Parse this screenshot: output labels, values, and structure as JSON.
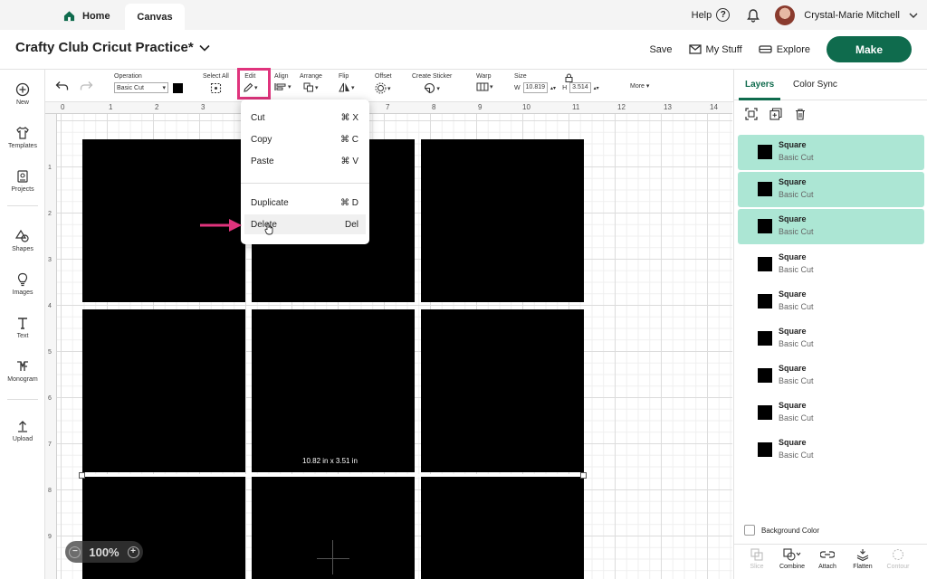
{
  "topbar": {
    "home_label": "Home",
    "canvas_label": "Canvas",
    "help_label": "Help",
    "user_name": "Crystal-Marie Mitchell"
  },
  "titlebar": {
    "project_title": "Crafty Club Cricut Practice*",
    "save_label": "Save",
    "mystuff_label": "My Stuff",
    "explore_label": "Explore",
    "make_label": "Make"
  },
  "leftbar": {
    "items": [
      {
        "label": "New",
        "icon": "plus-circle-icon"
      },
      {
        "label": "Templates",
        "icon": "shirt-icon"
      },
      {
        "label": "Projects",
        "icon": "projects-icon"
      },
      {
        "label": "Shapes",
        "icon": "shapes-icon"
      },
      {
        "label": "Images",
        "icon": "lightbulb-icon"
      },
      {
        "label": "Text",
        "icon": "text-icon"
      },
      {
        "label": "Monogram",
        "icon": "monogram-icon"
      },
      {
        "label": "Upload",
        "icon": "upload-icon"
      }
    ]
  },
  "toolbar": {
    "operation_label": "Operation",
    "operation_value": "Basic Cut",
    "select_all_label": "Select All",
    "edit_label": "Edit",
    "align_label": "Align",
    "arrange_label": "Arrange",
    "flip_label": "Flip",
    "offset_label": "Offset",
    "sticker_label": "Create Sticker",
    "warp_label": "Warp",
    "size_label": "Size",
    "w_label": "W",
    "w_value": "10.819",
    "h_label": "H",
    "h_value": "3.514",
    "more_label": "More"
  },
  "ruler": {
    "top": [
      "0",
      "1",
      "2",
      "3",
      "4",
      "5",
      "6",
      "7",
      "8",
      "9",
      "10",
      "11",
      "12",
      "13",
      "14"
    ],
    "left": [
      "1",
      "2",
      "3",
      "4",
      "5",
      "6",
      "7",
      "8",
      "9"
    ]
  },
  "canvas": {
    "dimension_label": "10.82  in x 3.51  in",
    "zoom_minus": "−",
    "zoom_value": "100%",
    "zoom_plus": "+"
  },
  "edit_menu": {
    "items": [
      {
        "label": "Cut",
        "shortcut": "⌘ X"
      },
      {
        "label": "Copy",
        "shortcut": "⌘ C"
      },
      {
        "label": "Paste",
        "shortcut": "⌘ V"
      },
      {
        "label": "Duplicate",
        "shortcut": "⌘ D"
      },
      {
        "label": "Delete",
        "shortcut": "Del"
      }
    ]
  },
  "rightpanel": {
    "tab_layers": "Layers",
    "tab_colorsync": "Color Sync",
    "layers": [
      {
        "name": "Square",
        "op": "Basic Cut",
        "selected": true
      },
      {
        "name": "Square",
        "op": "Basic Cut",
        "selected": true
      },
      {
        "name": "Square",
        "op": "Basic Cut",
        "selected": true
      },
      {
        "name": "Square",
        "op": "Basic Cut",
        "selected": false
      },
      {
        "name": "Square",
        "op": "Basic Cut",
        "selected": false
      },
      {
        "name": "Square",
        "op": "Basic Cut",
        "selected": false
      },
      {
        "name": "Square",
        "op": "Basic Cut",
        "selected": false
      },
      {
        "name": "Square",
        "op": "Basic Cut",
        "selected": false
      },
      {
        "name": "Square",
        "op": "Basic Cut",
        "selected": false
      }
    ],
    "bg_color_label": "Background Color",
    "bottom": [
      {
        "label": "Slice",
        "disabled": true
      },
      {
        "label": "Combine",
        "disabled": false
      },
      {
        "label": "Attach",
        "disabled": false
      },
      {
        "label": "Flatten",
        "disabled": false
      },
      {
        "label": "Contour",
        "disabled": true
      }
    ]
  },
  "colors": {
    "brand_green": "#0f6b4d",
    "highlight_pink": "#e0347d",
    "selected_layer": "#ace6d4"
  }
}
